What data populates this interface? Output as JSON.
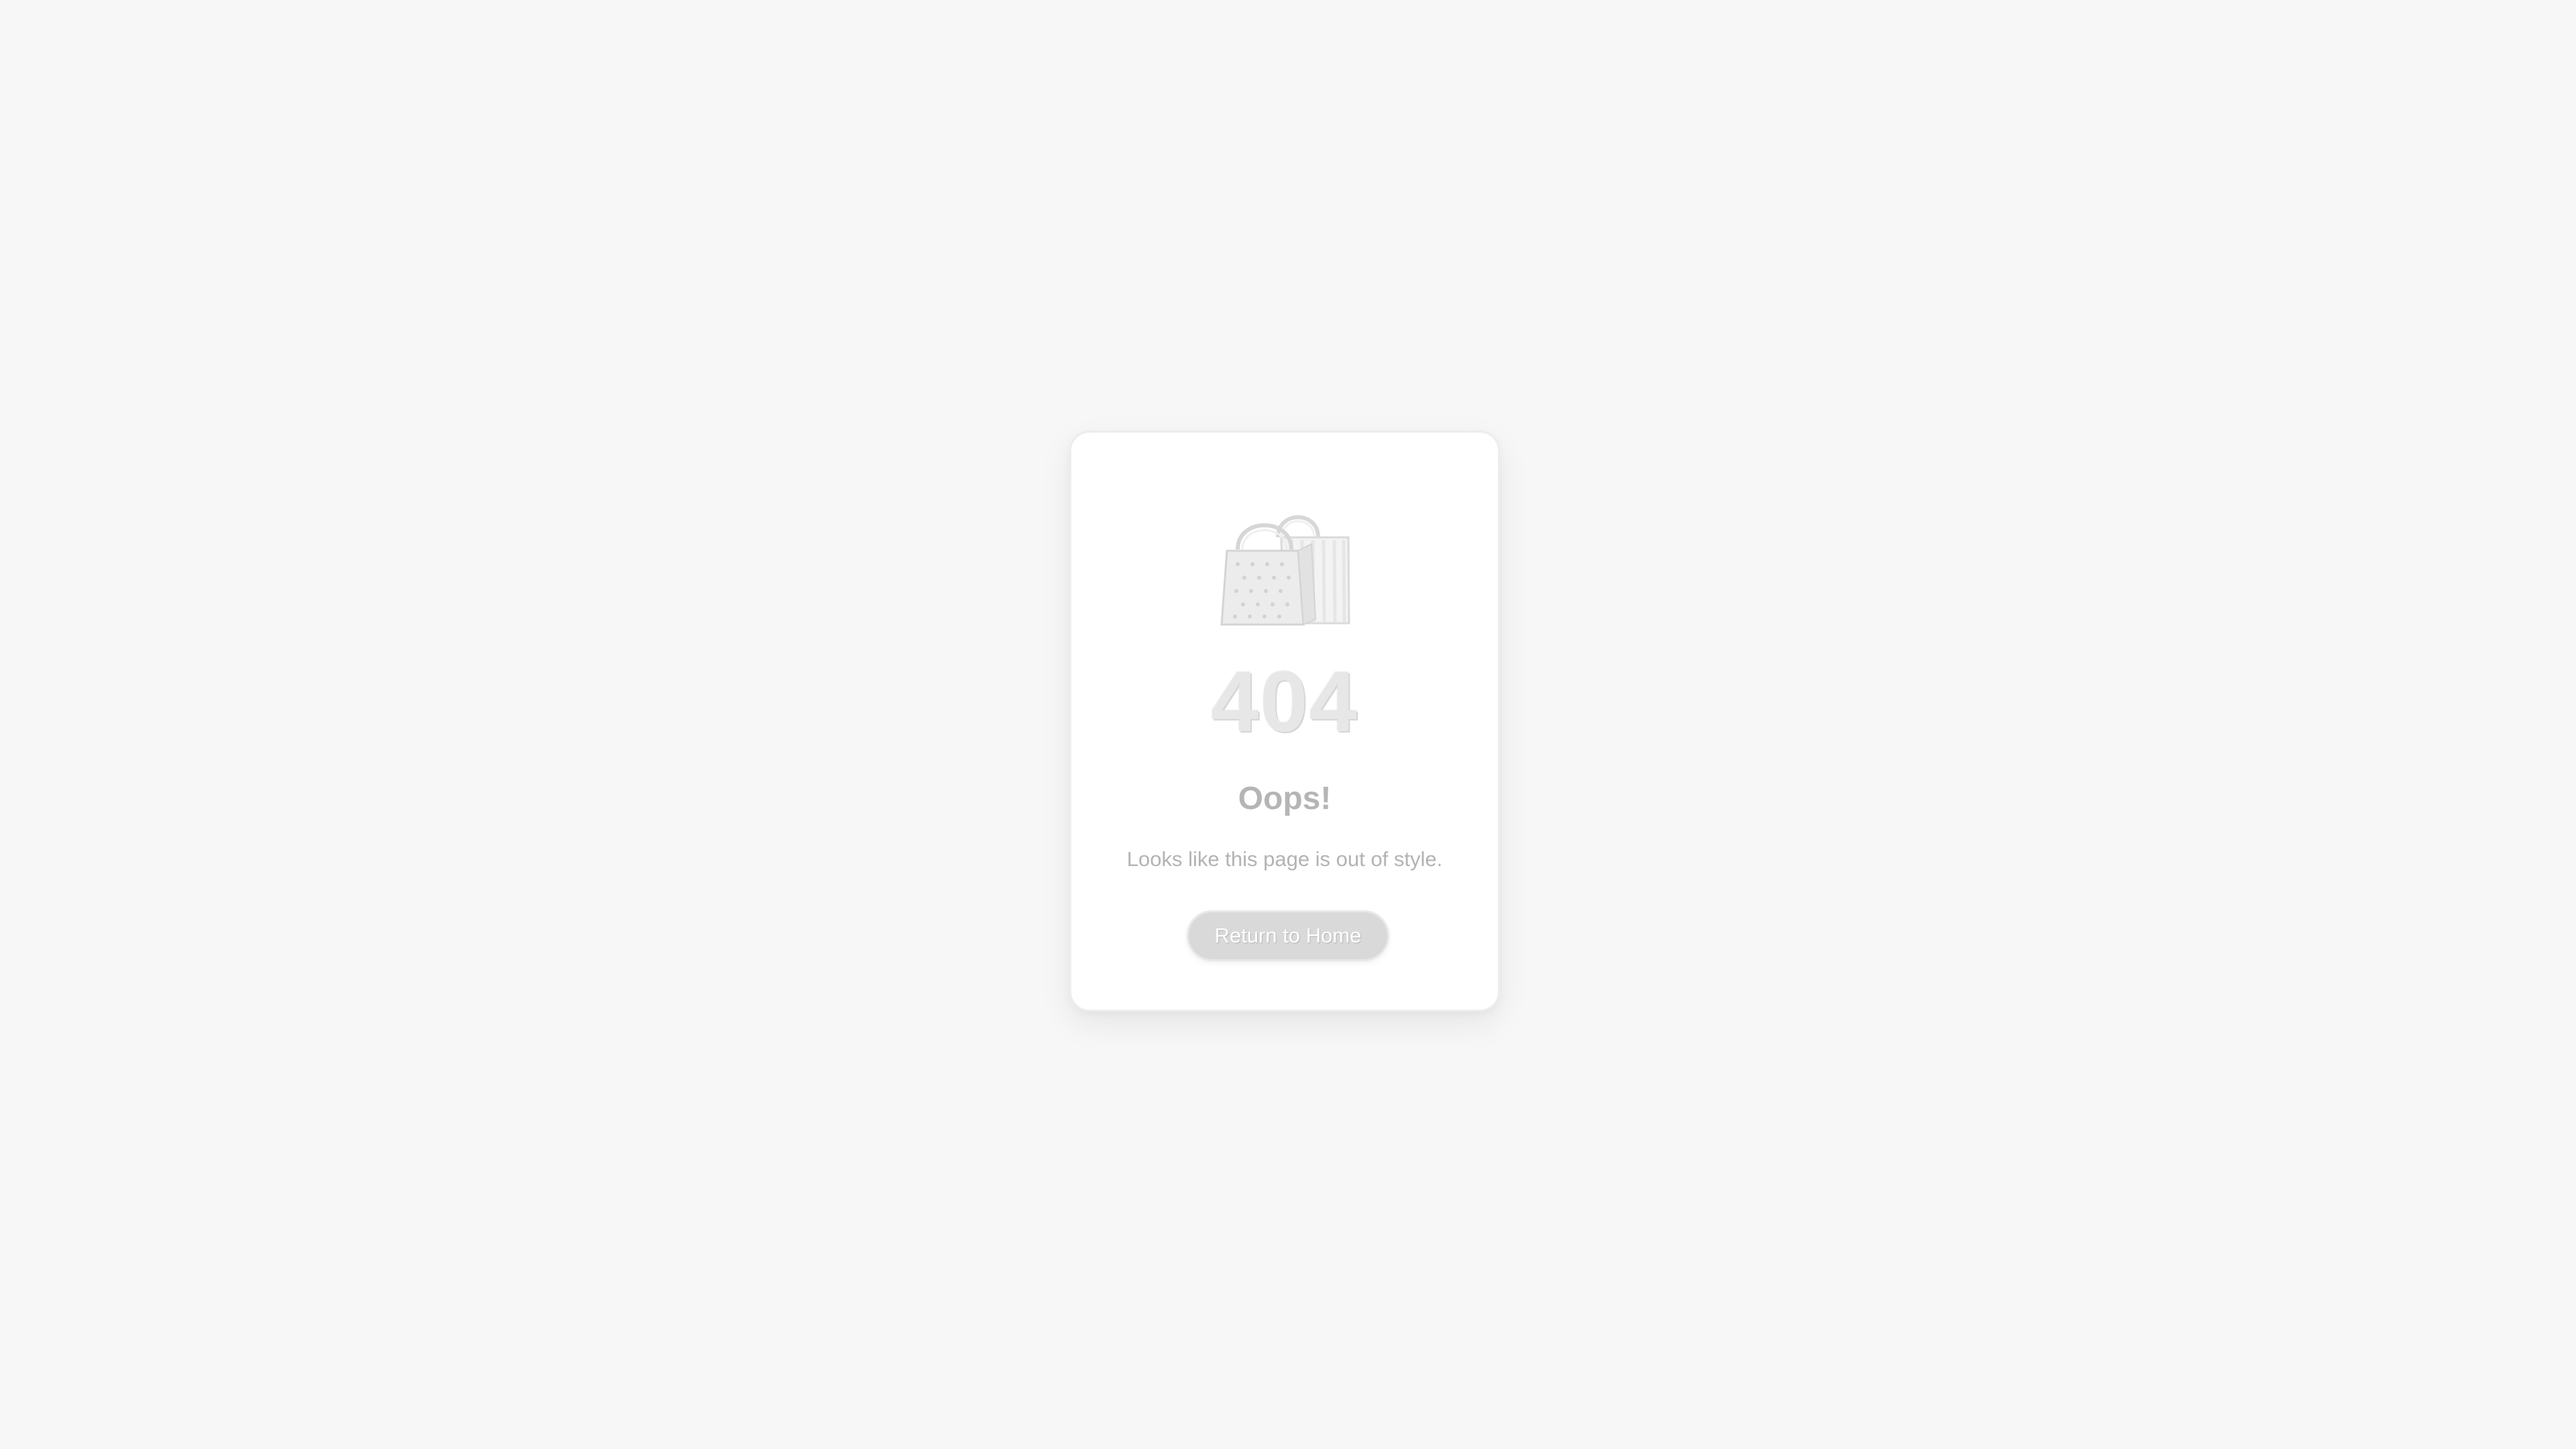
{
  "error_card": {
    "icon": "shopping-bags-icon",
    "code": "404",
    "title": "Oops!",
    "message": "Looks like this page is out of style.",
    "button_label": "Return to Home"
  },
  "colors": {
    "background": "#f7f7f7",
    "card": "#ffffff",
    "button": "#d9d9d9"
  }
}
